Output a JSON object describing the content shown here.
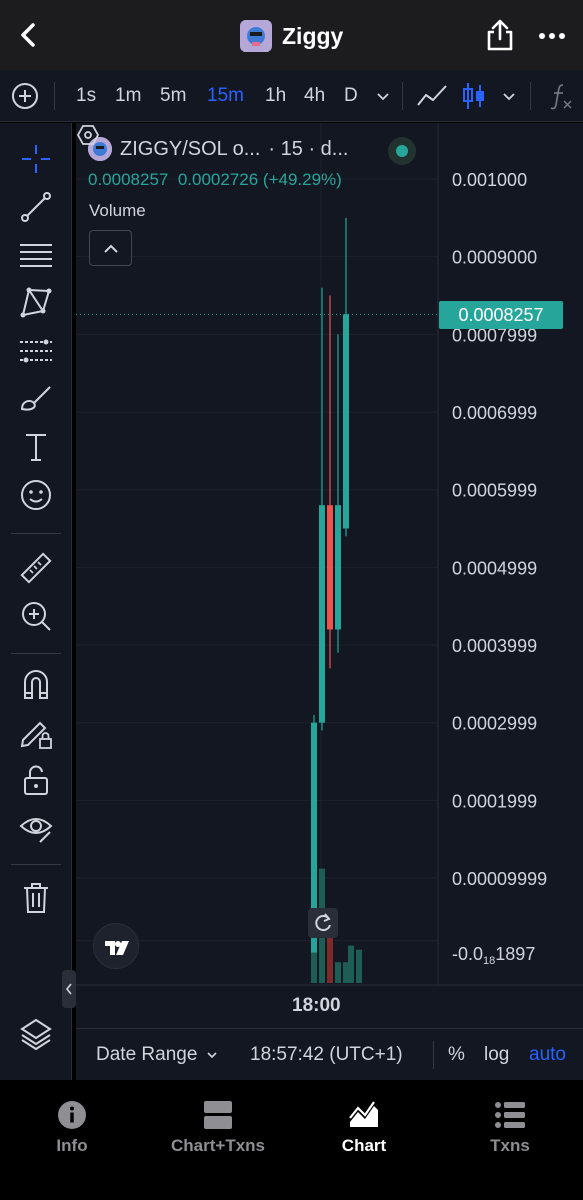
{
  "header": {
    "title": "Ziggy",
    "icons": [
      "back-chevron-icon",
      "share-icon",
      "more-icon"
    ]
  },
  "toolbar": {
    "timeframes": [
      "1s",
      "1m",
      "5m",
      "15m",
      "1h",
      "4h",
      "D"
    ],
    "active_timeframe": "15m",
    "icons": [
      "add-circle-icon",
      "chevron-down-icon",
      "line-chart-icon",
      "candles-icon",
      "chevron-down-icon",
      "indicators-fx-icon"
    ]
  },
  "left_tools": [
    "crosshair-icon",
    "trendline-icon",
    "horizontal-lines-icon",
    "pattern-icon",
    "fib-icon",
    "brush-icon",
    "text-icon",
    "emoji-icon",
    "ruler-icon",
    "zoom-in-icon",
    "magnet-icon",
    "lock-drawing-icon",
    "unlock-icon",
    "eye-icon",
    "trash-icon",
    "layers-icon"
  ],
  "legend": {
    "pair": "ZIGGY/SOL o...",
    "interval": "· 15 · d...",
    "price": "0.0008257",
    "change": "0.0002726 (+49.29%)",
    "volume_label": "Volume"
  },
  "price_axis": {
    "labels": [
      "0.001000",
      "0.0009000",
      "0.0007999",
      "0.0006999",
      "0.0005999",
      "0.0004999",
      "0.0003999",
      "0.0002999",
      "0.0001999",
      "0.00009999"
    ],
    "bottom_label_prefix": "-0.0",
    "bottom_label_sub": "18",
    "bottom_label_suffix": "1897",
    "current_price": "0.0008257"
  },
  "time_axis": {
    "label": "18:00"
  },
  "bottom_bar": {
    "date_range": "Date Range",
    "clock": "18:57:42 (UTC+1)",
    "percent": "%",
    "log": "log",
    "auto": "auto"
  },
  "tabs": [
    {
      "label": "Info",
      "icon": "info-icon"
    },
    {
      "label": "Chart+Txns",
      "icon": "split-view-icon"
    },
    {
      "label": "Chart",
      "icon": "area-chart-icon"
    },
    {
      "label": "Txns",
      "icon": "list-icon"
    }
  ],
  "active_tab": "Chart",
  "colors": {
    "up": "#26a69a",
    "down": "#ef5350",
    "accent": "#2962ff",
    "background": "#131722"
  },
  "chart_data": {
    "type": "candlestick",
    "interval": "15",
    "y_axis_ticks": [
      0.001,
      0.0009,
      0.0007999,
      0.0006999,
      0.0005999,
      0.0004999,
      0.0003999,
      0.0002999,
      0.0001999,
      9.999e-05
    ],
    "x_axis_ticks": [
      "18:00"
    ],
    "last_price": 0.0008257,
    "candles": [
      {
        "open": 4e-06,
        "high": 0.00031,
        "low": 4e-06,
        "close": 0.0003,
        "dir": "up"
      },
      {
        "open": 0.0003,
        "high": 0.00086,
        "low": 0.00029,
        "close": 0.00058,
        "dir": "up"
      },
      {
        "open": 0.00058,
        "high": 0.00085,
        "low": 0.00037,
        "close": 0.00042,
        "dir": "down"
      },
      {
        "open": 0.00042,
        "high": 0.0008,
        "low": 0.00039,
        "close": 0.00058,
        "dir": "up"
      },
      {
        "open": 0.00055,
        "high": 0.00095,
        "low": 0.00054,
        "close": 0.0008257,
        "dir": "up"
      }
    ],
    "volume": [
      {
        "value": 0.95,
        "dir": "up"
      },
      {
        "value": 0.55,
        "dir": "up"
      },
      {
        "value": 0.3,
        "dir": "down"
      },
      {
        "value": 0.1,
        "dir": "up"
      },
      {
        "value": 0.1,
        "dir": "up"
      }
    ]
  }
}
